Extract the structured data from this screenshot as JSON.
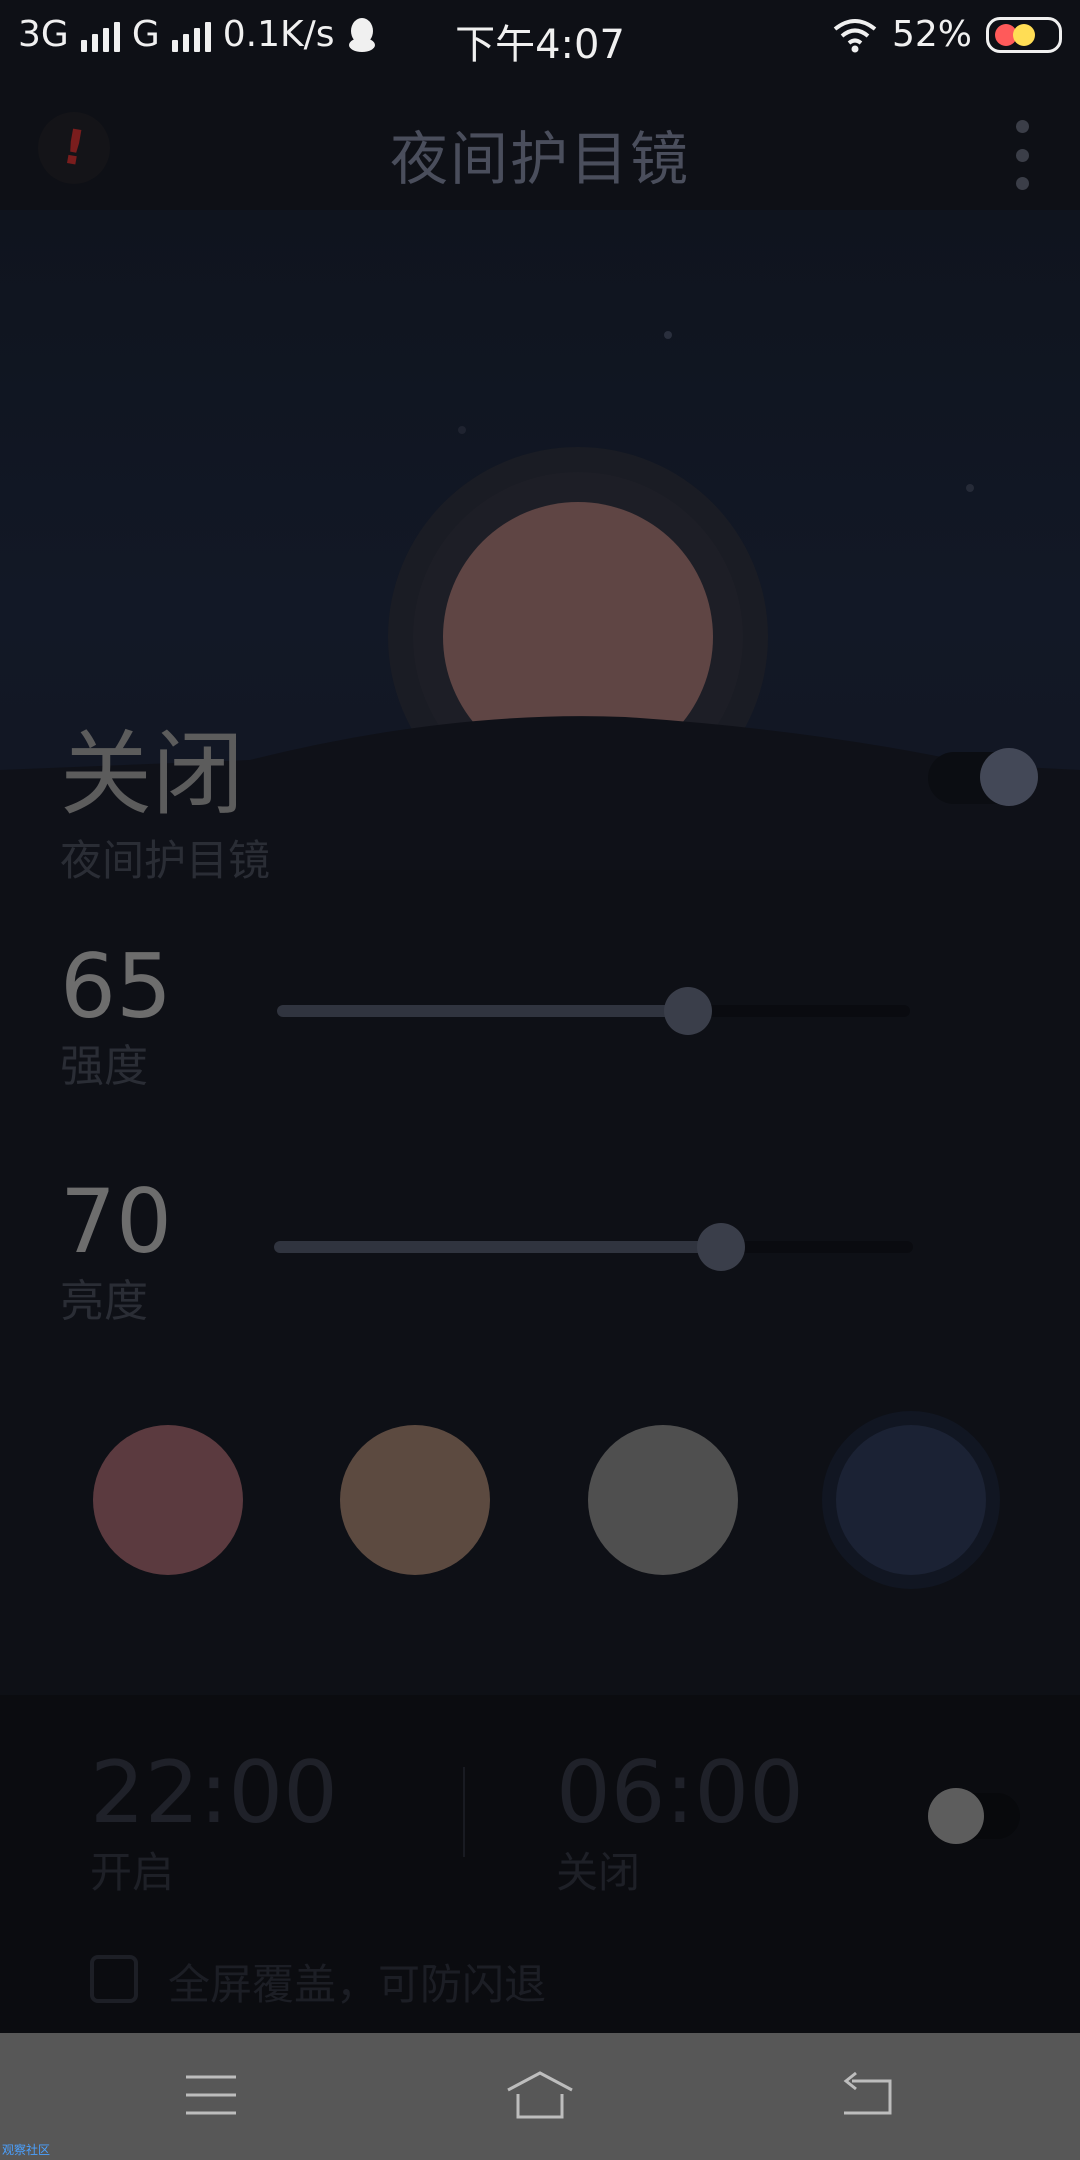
{
  "status_bar": {
    "network1": "3G",
    "network2": "G",
    "speed": "0.1K/s",
    "time": "下午4:07",
    "battery": "52%"
  },
  "header": {
    "title": "夜间护目镜",
    "alert_glyph": "!"
  },
  "main_switch": {
    "state": "关闭",
    "label": "夜间护目镜",
    "on": false
  },
  "intensity": {
    "value": "65",
    "label": "强度",
    "level": 65
  },
  "brightness": {
    "value": "70",
    "label": "亮度",
    "level": 70
  },
  "colors": [
    {
      "name": "red",
      "hex": "#5b3a3f"
    },
    {
      "name": "amber",
      "hex": "#5c4a40"
    },
    {
      "name": "gray",
      "hex": "#4f4f4f"
    },
    {
      "name": "blue",
      "hex": "#1b2234",
      "selected": true
    }
  ],
  "schedule": {
    "start_time": "22:00",
    "start_label": "开启",
    "end_time": "06:00",
    "end_label": "关闭",
    "enabled": false,
    "fullscreen_label": "全屏覆盖，可防闪退"
  },
  "icons": {
    "qq": "qq-icon",
    "wifi": "wifi-icon",
    "menu": "menu-icon",
    "home": "home-icon",
    "back": "back-icon"
  },
  "watermark": "观察社区"
}
